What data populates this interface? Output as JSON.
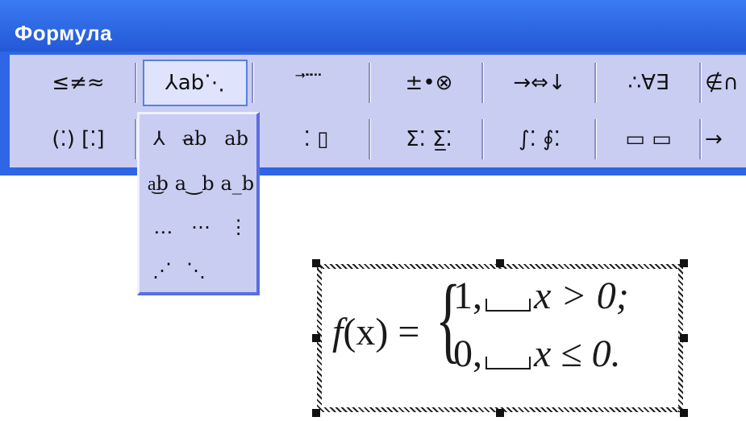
{
  "window": {
    "title": "Формула"
  },
  "palette": {
    "row1": [
      {
        "name": "relations-palette-button",
        "label": "≤≠≈",
        "pressed": false
      },
      {
        "name": "spaces-dots-palette-button",
        "label": "⅄ab⋱",
        "pressed": true
      },
      {
        "name": "embellishments-palette-button",
        "label": "⃗ ⃛ ⃜",
        "pressed": false
      },
      {
        "name": "operators-palette-button",
        "label": "±•⊗",
        "pressed": false
      },
      {
        "name": "arrows-palette-button",
        "label": "→⇔↓",
        "pressed": false
      },
      {
        "name": "logic-palette-button",
        "label": "∴∀∃",
        "pressed": false
      },
      {
        "name": "set-theory-palette-button",
        "label": "∉∩",
        "pressed": false
      }
    ],
    "row2": [
      {
        "name": "fences-palette-button",
        "label": "(⁚) [⁚]"
      },
      {
        "name": "fractions-radicals-palette-button",
        "label": ""
      },
      {
        "name": "subscript-palette-button",
        "label": "⁚ ▯"
      },
      {
        "name": "summation-palette-button",
        "label": "Σ⁚ Σ̲⁚"
      },
      {
        "name": "integrals-palette-button",
        "label": "∫⁚ ∮⁚"
      },
      {
        "name": "underbar-overbar-palette-button",
        "label": "▭ ▭"
      },
      {
        "name": "labeled-arrows-palette-button",
        "label": "→"
      }
    ]
  },
  "dropdown": {
    "rows": [
      [
        "⅄",
        "a̶b",
        "ab"
      ],
      [
        "a͜b",
        "a‿b",
        "a_b"
      ],
      [
        "…",
        "⋯",
        "⋮"
      ],
      [
        "⋰",
        "⋱"
      ]
    ]
  },
  "formula": {
    "lhs_f": "f",
    "lhs_paren": "(x) =",
    "case1_value": "1,",
    "case1_cond": "x > 0;",
    "case2_value": "0,",
    "case2_cond": "x ≤ 0."
  }
}
